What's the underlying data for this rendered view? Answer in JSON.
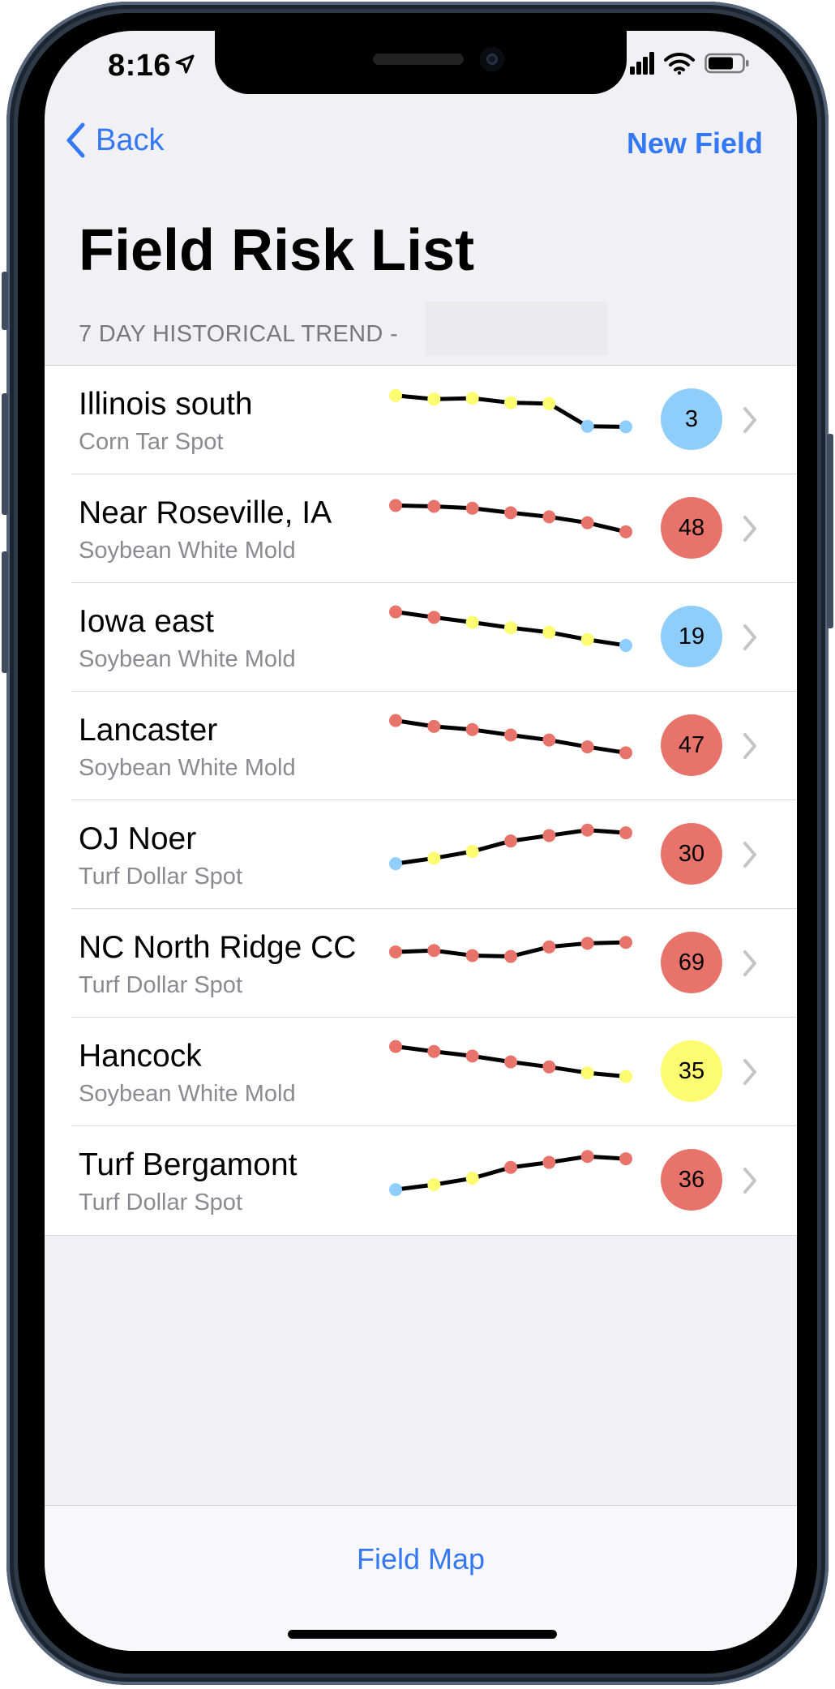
{
  "status_bar": {
    "time": "8:16"
  },
  "nav": {
    "back_label": "Back",
    "new_field_label": "New Field"
  },
  "page": {
    "title": "Field Risk List",
    "section_header": "7 DAY HISTORICAL TREND -"
  },
  "colors": {
    "accent": "#3478f6",
    "risk_high": "#e8736a",
    "risk_medium": "#fdfb6f",
    "risk_low": "#8fcefa"
  },
  "rows": [
    {
      "name": "Illinois south",
      "disease": "Corn Tar Spot",
      "score": "3",
      "risk": "low",
      "trend": [
        {
          "v": 0.88,
          "r": "medium"
        },
        {
          "v": 0.8,
          "r": "medium"
        },
        {
          "v": 0.82,
          "r": "medium"
        },
        {
          "v": 0.72,
          "r": "medium"
        },
        {
          "v": 0.7,
          "r": "medium"
        },
        {
          "v": 0.2,
          "r": "low"
        },
        {
          "v": 0.19,
          "r": "low"
        }
      ]
    },
    {
      "name": "Near Roseville, IA",
      "disease": "Soybean White Mold",
      "score": "48",
      "risk": "high",
      "trend": [
        {
          "v": 0.85,
          "r": "high"
        },
        {
          "v": 0.83,
          "r": "high"
        },
        {
          "v": 0.79,
          "r": "high"
        },
        {
          "v": 0.69,
          "r": "high"
        },
        {
          "v": 0.6,
          "r": "high"
        },
        {
          "v": 0.47,
          "r": "high"
        },
        {
          "v": 0.27,
          "r": "high"
        }
      ]
    },
    {
      "name": "Iowa east",
      "disease": "Soybean White Mold",
      "score": "19",
      "risk": "low",
      "trend": [
        {
          "v": 0.9,
          "r": "high"
        },
        {
          "v": 0.78,
          "r": "high"
        },
        {
          "v": 0.67,
          "r": "medium"
        },
        {
          "v": 0.55,
          "r": "medium"
        },
        {
          "v": 0.45,
          "r": "medium"
        },
        {
          "v": 0.29,
          "r": "medium"
        },
        {
          "v": 0.16,
          "r": "low"
        }
      ]
    },
    {
      "name": "Lancaster",
      "disease": "Soybean White Mold",
      "score": "47",
      "risk": "high",
      "trend": [
        {
          "v": 0.9,
          "r": "high"
        },
        {
          "v": 0.77,
          "r": "high"
        },
        {
          "v": 0.7,
          "r": "high"
        },
        {
          "v": 0.58,
          "r": "high"
        },
        {
          "v": 0.47,
          "r": "high"
        },
        {
          "v": 0.32,
          "r": "high"
        },
        {
          "v": 0.19,
          "r": "high"
        }
      ]
    },
    {
      "name": "OJ Noer",
      "disease": "Turf Dollar Spot",
      "score": "30",
      "risk": "high",
      "trend": [
        {
          "v": 0.14,
          "r": "low"
        },
        {
          "v": 0.26,
          "r": "medium"
        },
        {
          "v": 0.41,
          "r": "medium"
        },
        {
          "v": 0.64,
          "r": "high"
        },
        {
          "v": 0.76,
          "r": "high"
        },
        {
          "v": 0.88,
          "r": "high"
        },
        {
          "v": 0.82,
          "r": "high"
        }
      ]
    },
    {
      "name": "NC North Ridge CC",
      "disease": "Turf Dollar Spot",
      "score": "69",
      "risk": "high",
      "trend": [
        {
          "v": 0.59,
          "r": "high"
        },
        {
          "v": 0.62,
          "r": "high"
        },
        {
          "v": 0.51,
          "r": "high"
        },
        {
          "v": 0.49,
          "r": "high"
        },
        {
          "v": 0.7,
          "r": "high"
        },
        {
          "v": 0.78,
          "r": "high"
        },
        {
          "v": 0.8,
          "r": "high"
        }
      ]
    },
    {
      "name": "Hancock",
      "disease": "Soybean White Mold",
      "score": "35",
      "risk": "medium",
      "trend": [
        {
          "v": 0.9,
          "r": "high"
        },
        {
          "v": 0.79,
          "r": "high"
        },
        {
          "v": 0.69,
          "r": "high"
        },
        {
          "v": 0.56,
          "r": "high"
        },
        {
          "v": 0.45,
          "r": "high"
        },
        {
          "v": 0.32,
          "r": "medium"
        },
        {
          "v": 0.24,
          "r": "medium"
        }
      ]
    },
    {
      "name": "Turf Bergamont",
      "disease": "Turf Dollar Spot",
      "score": "36",
      "risk": "high",
      "trend": [
        {
          "v": 0.14,
          "r": "low"
        },
        {
          "v": 0.25,
          "r": "medium"
        },
        {
          "v": 0.39,
          "r": "medium"
        },
        {
          "v": 0.63,
          "r": "high"
        },
        {
          "v": 0.74,
          "r": "high"
        },
        {
          "v": 0.87,
          "r": "high"
        },
        {
          "v": 0.82,
          "r": "high"
        }
      ]
    }
  ],
  "toolbar": {
    "field_map_label": "Field Map"
  }
}
